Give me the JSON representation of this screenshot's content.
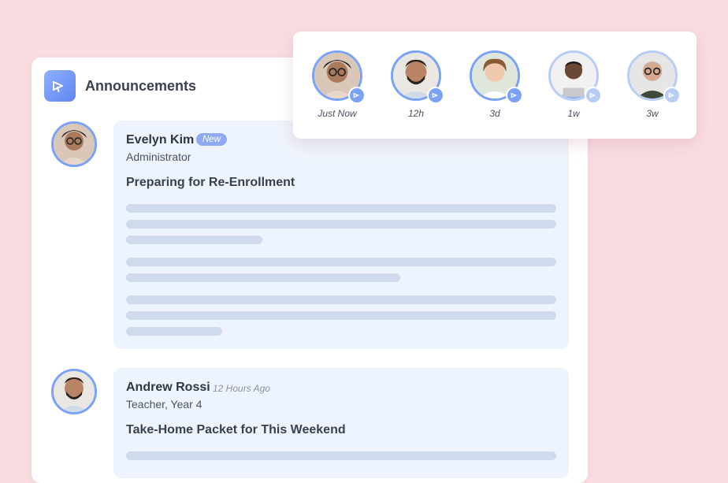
{
  "header": {
    "title": "Announcements",
    "icon": "megaphone-icon"
  },
  "posts": [
    {
      "name": "Evelyn Kim",
      "badge": "New",
      "role": "Administrator",
      "subject": "Preparing for Re-Enrollment",
      "avatar": "woman-glasses-avatar"
    },
    {
      "name": "Andrew Rossi",
      "time": "12 Hours Ago",
      "role": "Teacher, Year 4",
      "subject": "Take-Home Packet for This Weekend",
      "avatar": "man-beard-avatar"
    }
  ],
  "stories": [
    {
      "time": "Just Now",
      "avatar": "woman-glasses-avatar"
    },
    {
      "time": "12h",
      "avatar": "man-beard-avatar"
    },
    {
      "time": "3d",
      "avatar": "woman-smiling-avatar"
    },
    {
      "time": "1w",
      "avatar": "man-laptop-avatar"
    },
    {
      "time": "3w",
      "avatar": "older-man-avatar"
    }
  ],
  "colors": {
    "accent": "#7aa2f5",
    "background": "#f9dde1",
    "bubble": "#eef4fd",
    "placeholder": "#cfdbec"
  }
}
